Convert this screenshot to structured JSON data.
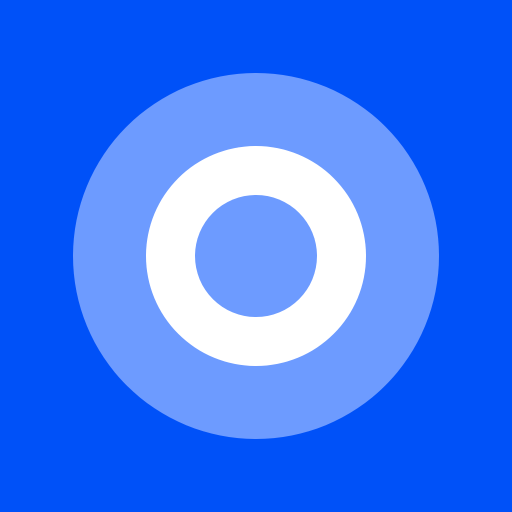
{
  "app_icon": {
    "icon_name": "target-ring-icon",
    "colors": {
      "background": "#0051f8",
      "outer_disc": "#6d9bff",
      "ring": "#ffffff",
      "inner_disc": "#6d9bff"
    }
  }
}
